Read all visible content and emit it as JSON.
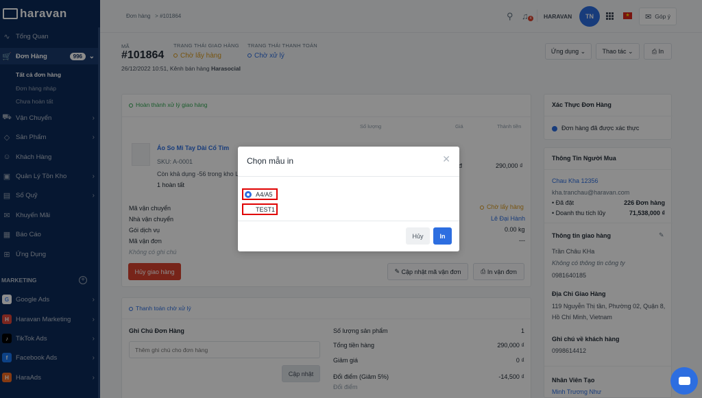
{
  "app": {
    "brand": "haravan",
    "shop": "HARAVAN",
    "avatar": "TN",
    "feedback": "Góp ý",
    "notif_count": "4"
  },
  "sidebar": {
    "items": [
      {
        "label": "Tổng Quan",
        "icon": "chart-line-icon"
      },
      {
        "label": "Đơn Hàng",
        "icon": "cart-icon",
        "badge": "996"
      },
      {
        "label": "Vận Chuyển",
        "icon": "truck-icon"
      },
      {
        "label": "Sản Phẩm",
        "icon": "tag-icon"
      },
      {
        "label": "Khách Hàng",
        "icon": "user-icon"
      },
      {
        "label": "Quản Lý Tồn Kho",
        "icon": "box-icon"
      },
      {
        "label": "Sổ Quỹ",
        "icon": "wallet-icon"
      },
      {
        "label": "Khuyến Mãi",
        "icon": "gift-icon"
      },
      {
        "label": "Báo Cáo",
        "icon": "report-icon"
      },
      {
        "label": "Ứng Dụng",
        "icon": "apps-icon"
      }
    ],
    "subitems": [
      "Tất cả đơn hàng",
      "Đơn hàng nháp",
      "Chưa hoàn tất"
    ],
    "section": "MARKETING",
    "apps": [
      {
        "label": "Google Ads",
        "icon": "G"
      },
      {
        "label": "Haravan Marketing",
        "icon": "H"
      },
      {
        "label": "TikTok Ads",
        "icon": "♪"
      },
      {
        "label": "Facebook Ads",
        "icon": "f"
      },
      {
        "label": "HaraAds",
        "icon": "H"
      }
    ]
  },
  "breadcrumb": {
    "parent": "Đơn hàng",
    "sep": ">",
    "current": "#101864"
  },
  "order": {
    "code_label": "MÃ",
    "code": "#101864",
    "ship_label": "TRẠNG THÁI GIAO HÀNG",
    "ship_status": "Chờ lấy hàng",
    "pay_label": "TRẠNG THÁI THANH TOÁN",
    "pay_status": "Chờ xử lý",
    "meta": "26/12/2022 10:51, Kênh bán hàng",
    "channel": "Harasocial"
  },
  "actions": {
    "apps": "Ứng dụng",
    "more": "Thao tác",
    "print": "In"
  },
  "fulfill": {
    "title": "Hoàn thành xử lý giao hàng",
    "col_qty": "Số lượng",
    "col_price": "Giá",
    "col_total": "Thành tiền",
    "product": "Áo So Mi Tay Dài Cổ Tim",
    "sku": "SKU: A-0001",
    "stock": "Còn khả dụng -56 trong kho L",
    "done": "1 hoàn tất",
    "price": "đ",
    "total": "290,000 ₫",
    "rows": [
      {
        "label": "Mã vận chuyển",
        "value": "Chờ lấy hàng"
      },
      {
        "label": "Nhà vận chuyển",
        "value": "Lê Đại Hành"
      },
      {
        "label": "Gói dịch vụ",
        "value": "0.00 kg"
      },
      {
        "label": "Mã vận đơn",
        "value": "---"
      }
    ],
    "note": "Không có ghi chú",
    "cancel": "Hủy giao hàng",
    "update": "Cập nhật mã vận đơn",
    "print": "In vận đơn"
  },
  "payment": {
    "title": "Thanh toán chờ xử lý",
    "note_title": "Ghi Chú Đơn Hàng",
    "note_placeholder": "Thêm ghi chú cho đơn hàng",
    "note_btn": "Cập nhật",
    "rows": [
      {
        "label": "Số lượng sản phẩm",
        "value": "1"
      },
      {
        "label": "Tổng tiền hàng",
        "value": "290,000 ₫"
      },
      {
        "label": "Giảm giá",
        "value": "0 ₫"
      },
      {
        "label": "Đổi điểm (Giảm 5%)",
        "value": "-14,500 ₫"
      },
      {
        "label": "Đổi điểm",
        "value": ""
      }
    ]
  },
  "right": {
    "verify_title": "Xác Thực Đơn Hàng",
    "verify_text": "Đơn hàng đã được xác thực",
    "buyer_title": "Thông Tin Người Mua",
    "buyer_name": "Chau Kha 12356",
    "buyer_email": "kha.tranchau@haravan.com",
    "placed_label": "• Đã đặt",
    "placed_value": "226 Đơn hàng",
    "revenue_label": "• Doanh thu tích lũy",
    "revenue_value": "71,538,000 ₫",
    "ship_title": "Thông tin giao hàng",
    "ship_name": "Trần Châu KHa",
    "ship_company": "Không có thông tin công ty",
    "ship_phone": "0981640185",
    "addr_title": "Địa Chỉ Giao Hàng",
    "addr1": "119 Nguyễn Thị tần, Phường 02, Quận 8,",
    "addr2": "Hồ Chí Minh, Vietnam",
    "cnote_title": "Ghi chú về khách hàng",
    "cnote": "0998614412",
    "staff_title": "Nhân Viên Tạo",
    "staff": "Minh Trương Như"
  },
  "modal": {
    "title": "Chọn mẫu in",
    "options": [
      {
        "label": "A4/A5",
        "selected": true
      },
      {
        "label": "TEST1",
        "selected": false
      }
    ],
    "cancel": "Hủy",
    "ok": "In"
  },
  "colors": {
    "sidebar": "#0c2a5a",
    "primary": "#2d6ee0",
    "danger": "#d9432f",
    "warning": "#d99a1e",
    "success": "#32a852"
  }
}
